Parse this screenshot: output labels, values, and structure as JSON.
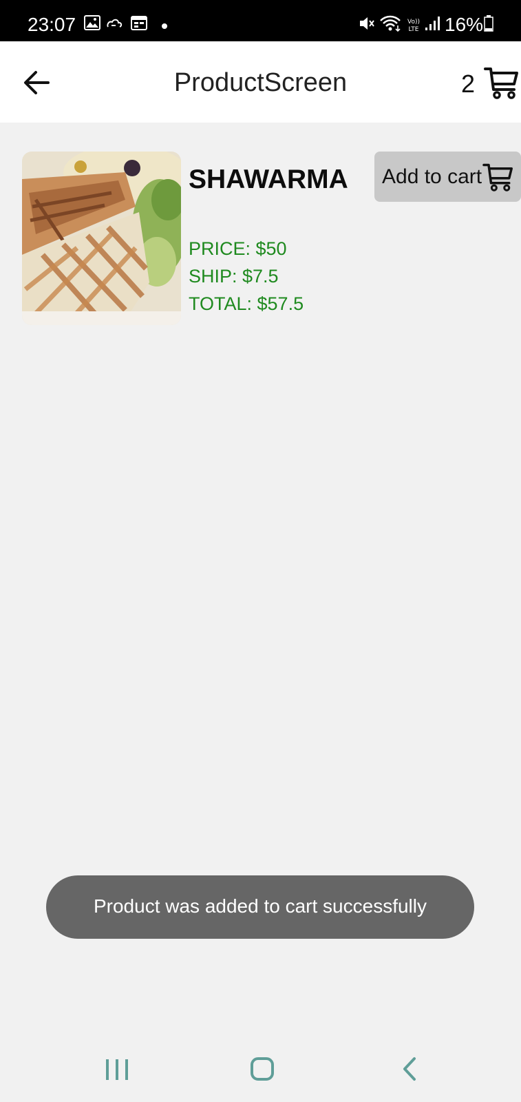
{
  "status_bar": {
    "time": "23:07",
    "battery_percent": "16%",
    "left_icons": [
      "gallery-icon",
      "cloud-icon",
      "calendar-icon",
      "dot-icon"
    ],
    "right_icons": [
      "mute-icon",
      "wifi-icon",
      "volte-icon",
      "signal-icon",
      "battery-icon"
    ]
  },
  "app_bar": {
    "title": "ProductScreen",
    "cart_count": "2",
    "back_icon": "arrow-left-icon",
    "cart_icon": "cart-icon"
  },
  "product": {
    "name": "SHAWARMA",
    "price_text": "PRICE: $50",
    "ship_text": "SHIP: $7.5",
    "total_text": "TOTAL: $57.5",
    "image": "shawarma-photo",
    "add_to_cart_label": "Add to cart",
    "add_to_cart_icon": "cart-icon"
  },
  "toast": {
    "message": "Product was added to cart successfully"
  },
  "nav_bar": {
    "items": [
      "recent-apps-icon",
      "home-icon",
      "back-icon"
    ]
  },
  "colors": {
    "status_bar_bg": "#000000",
    "app_bar_bg": "#ffffff",
    "page_bg": "#f1f1f1",
    "price_green": "#1f8a1f",
    "button_gray": "#c8c8c8",
    "toast_bg": "#666666",
    "nav_icon": "#5f9e98"
  }
}
